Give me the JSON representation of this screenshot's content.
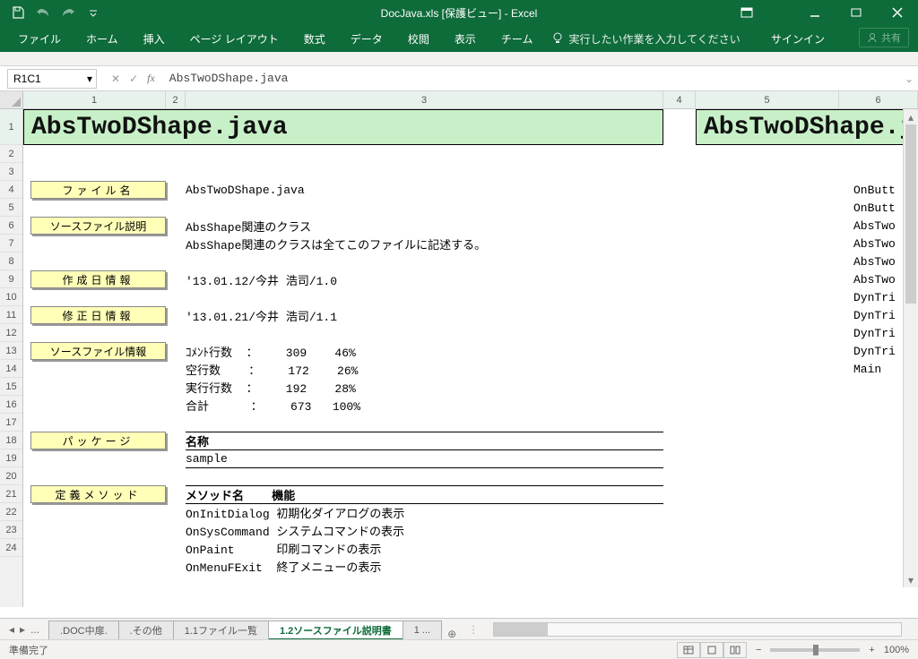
{
  "title": "DocJava.xls  [保護ビュー] - Excel",
  "ribbon": {
    "tabs": [
      "ファイル",
      "ホーム",
      "挿入",
      "ページ レイアウト",
      "数式",
      "データ",
      "校閲",
      "表示",
      "チーム"
    ],
    "tell_me": "実行したい作業を入力してください",
    "signin": "サインイン",
    "share": "共有"
  },
  "namebox": "R1C1",
  "formula": "AbsTwoDShape.java",
  "col_headers": [
    "1",
    "2",
    "3",
    "4",
    "5",
    "6"
  ],
  "row_headers": [
    "1",
    "2",
    "3",
    "4",
    "5",
    "6",
    "7",
    "8",
    "9",
    "10",
    "11",
    "12",
    "13",
    "14",
    "15",
    "16",
    "17",
    "18",
    "19",
    "20",
    "21",
    "22",
    "23",
    "24"
  ],
  "cells": {
    "title_a": "AbsTwoDShape.java",
    "title_b": "AbsTwoDShape.j",
    "labels": {
      "r3": "ファイル名",
      "r5": "ソースファイル説明",
      "r8": "作成日情報",
      "r10": "修正日情報",
      "r12": "ソースファイル情報",
      "r17": "パッケージ",
      "r20": "定義メソッド"
    },
    "c3": {
      "r3": "AbsTwoDShape.java",
      "r5": "AbsShape関連のクラス",
      "r6": "AbsShape関連のクラスは全てこのファイルに記述する。",
      "r8": "'13.01.12/今井 浩司/1.0",
      "r10": "'13.01.21/今井 浩司/1.1",
      "r12": "ｺﾒﾝﾄ行数  ：    309    46%",
      "r13": "空行数    ：    172    26%",
      "r14": "実行行数  ：    192    28%",
      "r15": "合計      ：    673   100%",
      "r17": "名称",
      "r18": "sample",
      "r20": "メソッド名    機能",
      "r21": "OnInitDialog 初期化ダイアログの表示",
      "r22": "OnSysCommand システムコマンドの表示",
      "r23": "OnPaint      印刷コマンドの表示",
      "r24": "OnMenuFExit  終了メニューの表示"
    },
    "c6": {
      "r3": "OnButt",
      "r4": "OnButt",
      "r5": "AbsTwo",
      "r6": "AbsTwo",
      "r7": "AbsTwo",
      "r8": "AbsTwo",
      "r9": "DynTri",
      "r10": "DynTri",
      "r11": "DynTri",
      "r12": "DynTri",
      "r13": "Main"
    }
  },
  "sheets": {
    "nav_dots": "...",
    "tabs": [
      ".DOC中扉.",
      ".その他",
      "1.1ファイル一覧",
      "1.2ソースファイル説明書",
      "1 ..."
    ],
    "active_index": 3,
    "add": "⊕"
  },
  "status": {
    "ready": "準備完了",
    "zoom": "100%"
  }
}
